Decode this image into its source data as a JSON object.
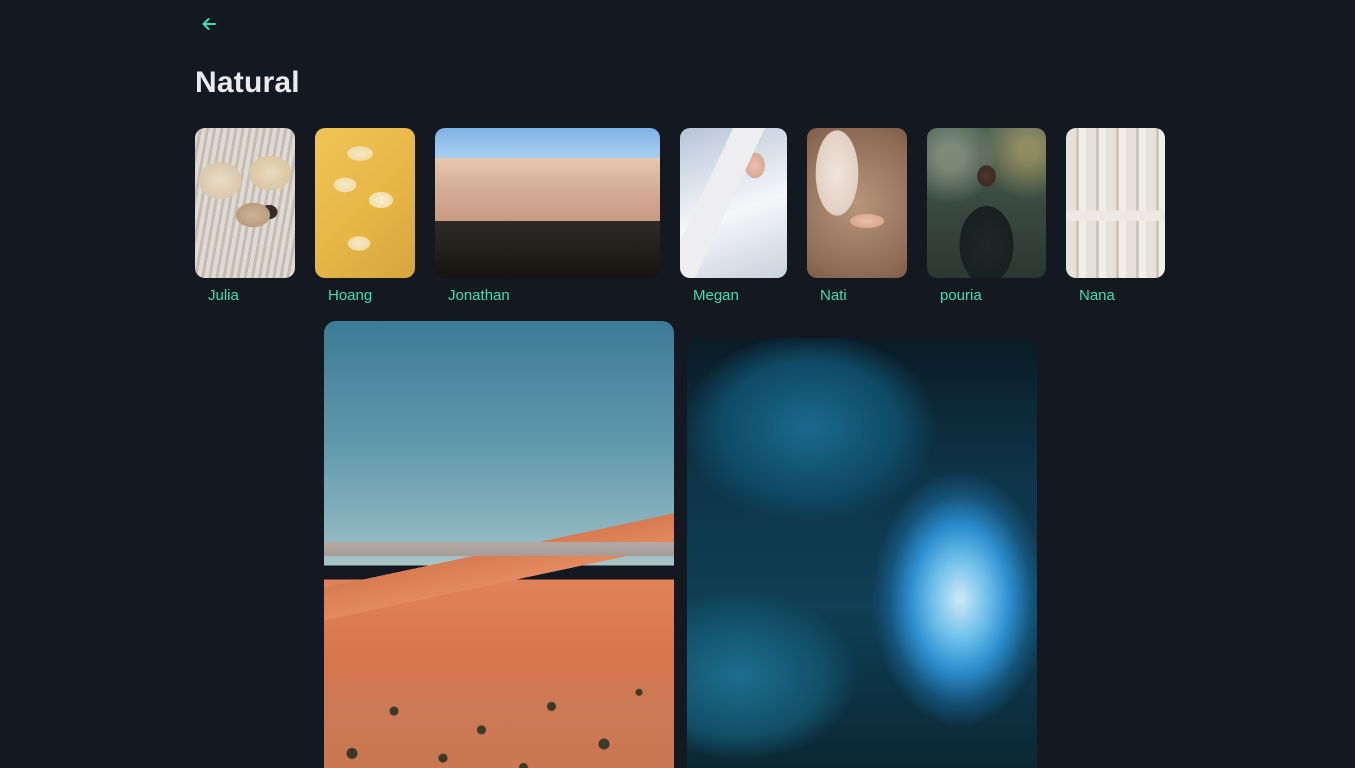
{
  "header": {
    "back_icon": "arrow-left-icon",
    "title": "Natural"
  },
  "colors": {
    "background": "#141821",
    "accent": "#3ee0b0",
    "title": "#e9ebf0"
  },
  "stories": [
    {
      "name": "Julia"
    },
    {
      "name": "Hoang"
    },
    {
      "name": "Jonathan"
    },
    {
      "name": "Megan"
    },
    {
      "name": "Nati"
    },
    {
      "name": "pouria"
    },
    {
      "name": "Nana"
    }
  ]
}
